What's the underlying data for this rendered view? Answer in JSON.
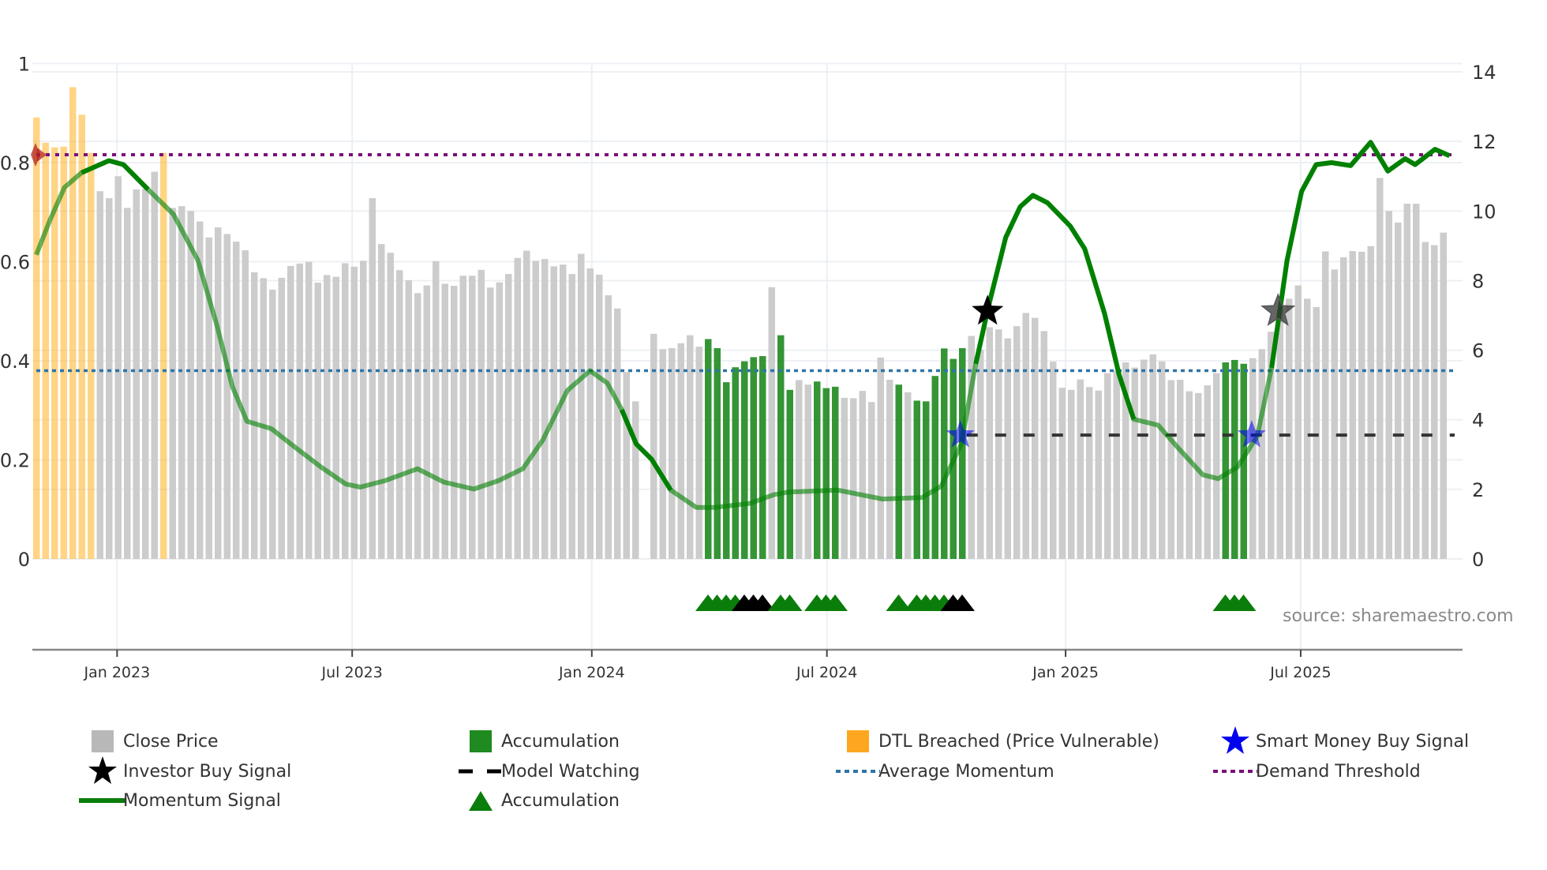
{
  "chart_data": {
    "type": "bar",
    "title": "",
    "left_axis": {
      "range": [
        0,
        1
      ],
      "ticks": [
        0,
        0.2,
        0.4,
        0.6,
        0.8,
        1
      ],
      "tick_labels": [
        "0",
        "0.2",
        "0.4",
        "0.6",
        "0.8",
        "1"
      ]
    },
    "right_axis": {
      "range": [
        0,
        14
      ],
      "ticks": [
        0,
        2,
        4,
        6,
        8,
        10,
        12,
        14
      ],
      "tick_labels": [
        "0",
        "2",
        "4",
        "6",
        "8",
        "10",
        "12",
        "14"
      ]
    },
    "x_axis": {
      "unit": "week index",
      "ticks": [
        8.9,
        34.8,
        61.2,
        87.1,
        113.4,
        139.3
      ],
      "tick_labels": [
        "Jan 2023",
        "Jul 2023",
        "Jan 2024",
        "Jul 2024",
        "Jan 2025",
        "Jul 2025"
      ]
    },
    "bars": {
      "name": "Close Price",
      "values": [
        12.69,
        11.96,
        11.83,
        11.85,
        13.56,
        12.77,
        11.67,
        10.57,
        10.37,
        11.0,
        10.09,
        10.62,
        10.64,
        11.13,
        11.67,
        10.09,
        10.14,
        10.0,
        9.7,
        9.24,
        9.53,
        9.34,
        9.12,
        8.87,
        8.24,
        8.07,
        7.74,
        8.08,
        8.42,
        8.49,
        8.54,
        7.94,
        8.16,
        8.11,
        8.5,
        8.4,
        8.57,
        10.37,
        9.05,
        8.8,
        8.3,
        8.01,
        7.64,
        7.86,
        8.56,
        7.91,
        7.85,
        8.14,
        8.14,
        8.31,
        7.8,
        7.95,
        8.19,
        8.65,
        8.86,
        8.57,
        8.62,
        8.41,
        8.46,
        8.19,
        8.77,
        8.35,
        8.17,
        7.58,
        7.2,
        5.37,
        4.53,
        null,
        6.47,
        6.03,
        6.06,
        6.2,
        6.43,
        6.1,
        6.32,
        6.06,
        5.08,
        5.51,
        5.68,
        5.8,
        5.83,
        7.81,
        6.43,
        4.86,
        5.14,
        5.01,
        5.1,
        4.91,
        4.95,
        4.63,
        4.62,
        4.83,
        4.51,
        5.79,
        5.15,
        5.01,
        4.79,
        4.55,
        4.53,
        5.26,
        6.05,
        5.75,
        6.06,
        6.41,
        6.01,
        6.66,
        6.6,
        6.34,
        6.69,
        7.07,
        6.93,
        6.55,
        5.67,
        4.92,
        4.86,
        5.16,
        4.94,
        4.84,
        5.34,
        5.41,
        5.65,
        5.5,
        5.73,
        5.88,
        5.68,
        5.14,
        5.15,
        4.82,
        4.77,
        4.99,
        5.34,
        5.65,
        5.72,
        5.61,
        5.77,
        6.03,
        6.53,
        7.18,
        7.48,
        7.86,
        7.48,
        7.24,
        8.84,
        8.32,
        8.67,
        8.85,
        8.83,
        8.99,
        10.95,
        10.0,
        9.67,
        10.21,
        10.21,
        9.11,
        9.02,
        9.38
      ],
      "dtl_breached_indices": [
        0,
        1,
        2,
        3,
        4,
        5,
        6,
        14
      ],
      "accumulation_indices": [
        74,
        75,
        76,
        77,
        78,
        79,
        80,
        82,
        83,
        86,
        87,
        88,
        95,
        97,
        98,
        99,
        100,
        101,
        102,
        131,
        132,
        133
      ]
    },
    "momentum_signal": {
      "name": "Momentum Signal",
      "points": [
        [
          0,
          0.614
        ],
        [
          1.5,
          0.684
        ],
        [
          3.1,
          0.75
        ],
        [
          5,
          0.78
        ],
        [
          8,
          0.804
        ],
        [
          9.6,
          0.796
        ],
        [
          12.3,
          0.746
        ],
        [
          15.1,
          0.696
        ],
        [
          17.8,
          0.603
        ],
        [
          19.9,
          0.471
        ],
        [
          21.6,
          0.348
        ],
        [
          23.2,
          0.278
        ],
        [
          25.9,
          0.263
        ],
        [
          28.6,
          0.224
        ],
        [
          31.4,
          0.185
        ],
        [
          34.1,
          0.151
        ],
        [
          35.7,
          0.145
        ],
        [
          38.4,
          0.158
        ],
        [
          42,
          0.182
        ],
        [
          44.9,
          0.155
        ],
        [
          48.2,
          0.141
        ],
        [
          50.9,
          0.158
        ],
        [
          53.6,
          0.182
        ],
        [
          55.8,
          0.24
        ],
        [
          58.5,
          0.34
        ],
        [
          61,
          0.38
        ],
        [
          62.9,
          0.355
        ],
        [
          64.5,
          0.301
        ],
        [
          66.1,
          0.232
        ],
        [
          67.8,
          0.201
        ],
        [
          69.9,
          0.139
        ],
        [
          72.7,
          0.104
        ],
        [
          74.8,
          0.104
        ],
        [
          78.6,
          0.112
        ],
        [
          81.3,
          0.13
        ],
        [
          82.9,
          0.135
        ],
        [
          88.3,
          0.139
        ],
        [
          93.2,
          0.121
        ],
        [
          97.6,
          0.124
        ],
        [
          99.7,
          0.147
        ],
        [
          101.9,
          0.232
        ],
        [
          103.5,
          0.394
        ],
        [
          104.9,
          0.51
        ],
        [
          106.8,
          0.649
        ],
        [
          108.4,
          0.711
        ],
        [
          109.8,
          0.734
        ],
        [
          111.4,
          0.719
        ],
        [
          113.9,
          0.672
        ],
        [
          115.5,
          0.626
        ],
        [
          117.7,
          0.495
        ],
        [
          119.3,
          0.371
        ],
        [
          120.9,
          0.282
        ],
        [
          123.6,
          0.27
        ],
        [
          125.8,
          0.224
        ],
        [
          128.5,
          0.17
        ],
        [
          130.2,
          0.162
        ],
        [
          132.3,
          0.185
        ],
        [
          134.5,
          0.247
        ],
        [
          136.1,
          0.386
        ],
        [
          137.8,
          0.603
        ],
        [
          139.4,
          0.742
        ],
        [
          141,
          0.796
        ],
        [
          142.7,
          0.8
        ],
        [
          144.8,
          0.794
        ],
        [
          147,
          0.841
        ],
        [
          148.9,
          0.783
        ],
        [
          150.8,
          0.808
        ],
        [
          151.9,
          0.796
        ],
        [
          154.1,
          0.827
        ],
        [
          155.7,
          0.814
        ]
      ],
      "emphasized_ranges": [
        [
          7,
          13
        ],
        [
          66,
          68
        ],
        [
          104,
          119.5
        ],
        [
          137,
          156
        ]
      ]
    },
    "average_momentum": 0.38,
    "demand_threshold": 0.816,
    "model_watching": {
      "value": 0.25,
      "from_index": 102.5
    },
    "investor_buy_signals": [
      [
        104.8,
        0.5,
        "solid"
      ],
      [
        136.8,
        0.5,
        "faded"
      ]
    ],
    "smart_money_buy_signals": [
      [
        101.8,
        0.25
      ],
      [
        133.9,
        0.25
      ]
    ],
    "dtl_marker": [
      0,
      0.816
    ],
    "accumulation_markers": [
      [
        74,
        "green"
      ],
      [
        75,
        "green"
      ],
      [
        76,
        "green"
      ],
      [
        77,
        "green"
      ],
      [
        78,
        "black"
      ],
      [
        79,
        "black"
      ],
      [
        80,
        "black"
      ],
      [
        82,
        "green"
      ],
      [
        83,
        "green"
      ],
      [
        86,
        "green"
      ],
      [
        87,
        "green"
      ],
      [
        88,
        "green"
      ],
      [
        95,
        "green"
      ],
      [
        97,
        "green"
      ],
      [
        98,
        "green"
      ],
      [
        99,
        "green"
      ],
      [
        100,
        "green"
      ],
      [
        101,
        "black"
      ],
      [
        102,
        "black"
      ],
      [
        131,
        "green"
      ],
      [
        132,
        "green"
      ],
      [
        133,
        "green"
      ]
    ],
    "legend_placement": "bottom",
    "grid": true
  },
  "colors": {
    "close": "#c9c9c9",
    "accumulation": "#1f8a1f",
    "dtl": "#ffb733",
    "momentum": "#008000",
    "average": "#2e75a8",
    "demand": "#7a0f7a",
    "watching": "#333333",
    "smart_money": "#0000ee"
  },
  "legend": {
    "close_price": "Close Price",
    "accumulation_bar": "Accumulation",
    "dtl_breached": "DTL Breached (Price Vulnerable)",
    "smart_money": "Smart Money Buy Signal",
    "investor_buy": "Investor Buy Signal",
    "model_watching": "Model Watching",
    "average_momentum": "Average Momentum",
    "demand_threshold": "Demand Threshold",
    "momentum_signal": "Momentum Signal",
    "accumulation_marker": "Accumulation"
  },
  "source": "source: sharemaestro.com"
}
